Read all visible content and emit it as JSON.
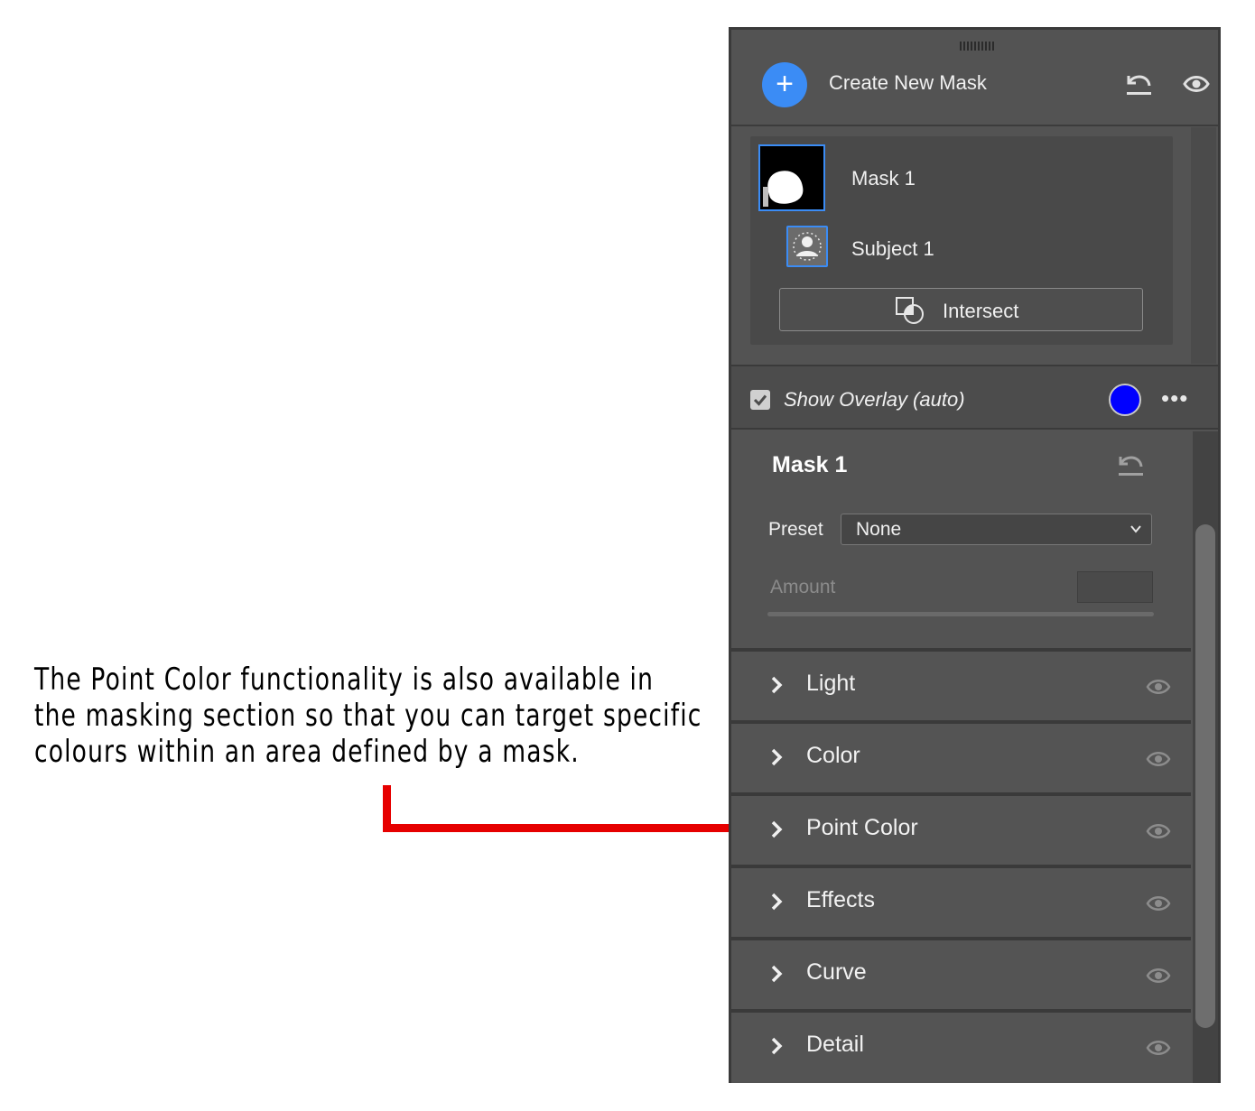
{
  "annotation": {
    "lines": [
      "The Point Color functionality is also available in",
      "the masking section so that you can target specific",
      "colours within an area defined by a mask."
    ],
    "callout_color": "#e60000"
  },
  "panel": {
    "create_label": "Create New Mask",
    "mask": {
      "name": "Mask 1",
      "subject": "Subject 1",
      "intersect_label": "Intersect"
    },
    "overlay": {
      "label": "Show Overlay (auto)",
      "checked": true,
      "color": "#0000ff",
      "more": "•••"
    },
    "properties": {
      "title": "Mask 1",
      "preset_label": "Preset",
      "preset_value": "None",
      "amount_label": "Amount"
    },
    "sections": [
      {
        "label": "Light"
      },
      {
        "label": "Color"
      },
      {
        "label": "Point Color"
      },
      {
        "label": "Effects"
      },
      {
        "label": "Curve"
      },
      {
        "label": "Detail"
      }
    ],
    "accent": "#3b8cf5",
    "icons": [
      "plus-icon",
      "undo-icon",
      "eye-icon",
      "subject-icon",
      "intersect-icon",
      "check-icon",
      "chevron-right-icon",
      "chevron-down-icon"
    ]
  }
}
